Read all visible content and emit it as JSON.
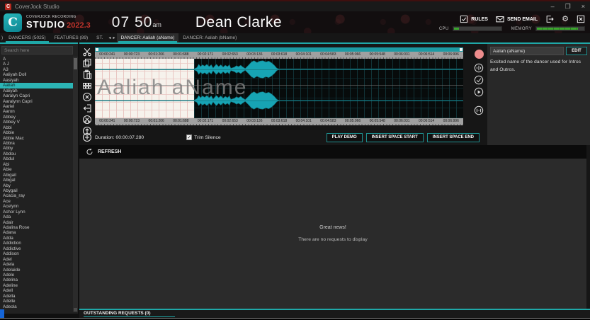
{
  "titlebar": {
    "app_title": "CoverJock Studio",
    "app_icon_letter": "C",
    "minimize": "–",
    "restore": "❐",
    "close": "×"
  },
  "header": {
    "logo_letter": "C",
    "brand_small": "COVERJOCK RECORDING",
    "brand_large": "STUDIO",
    "version": "2022.3",
    "time": "07 50",
    "time_suffix": "am",
    "user": "Dean Clarke",
    "rules_label": "RULES",
    "send_email_label": "SEND EMAIL",
    "gear_glyph": "⚙",
    "cpu_label": "CPU",
    "memory_label": "MEMORY",
    "cpu_percent": 10,
    "memory_percent": 85,
    "accent_color": "#1fa8a8",
    "meter_green": "#3aa72d"
  },
  "tabbar": {
    "fragment": ")",
    "nav_tabs": [
      {
        "label": "DANCERS (5025)"
      },
      {
        "label": "FEATURES (89)"
      },
      {
        "label": "ST."
      }
    ],
    "scroll_left": "◂",
    "scroll_right": "▸",
    "doc_tabs": [
      {
        "label": "DANCER: Aaliah (aName)",
        "active": true
      },
      {
        "label": "DANCER: Aaliah (bName)",
        "active": false
      }
    ]
  },
  "sidebar": {
    "search_placeholder": "Search here",
    "selected": "Aaliah",
    "items": [
      "A",
      "A J",
      "A3",
      "Aaliyah Doll",
      "Aasiyah",
      "Aaliah",
      "Aaliyah",
      "Aaralyn Capri",
      "Aaralynn Capri",
      "Aariel",
      "Aaron",
      "Abbey",
      "Abbey V",
      "Abbi",
      "Abbie",
      "Abbie Mac",
      "Abbra",
      "Abby",
      "Abdou",
      "Abdul",
      "Abi",
      "Abie",
      "Abigail",
      "Abigal",
      "Aby",
      "Abygail",
      "Acacia_ray",
      "Ace",
      "Acelynn",
      "Achor Lynn",
      "Ada",
      "Adair",
      "Adalina Rose",
      "Adana",
      "Adda",
      "Addiction",
      "Addictive",
      "Addison",
      "Adel",
      "Adela",
      "Adelaide",
      "Adele",
      "Adelina",
      "Adeline",
      "Adell",
      "Adella",
      "Adelle",
      "Adeola"
    ]
  },
  "wave": {
    "timeline": [
      "00:00:241",
      "00:00:723",
      "00:01:206",
      "00:01:688",
      "00:02:171",
      "00:02:653",
      "00:03:136",
      "00:03:618",
      "00:04:101",
      "00:04:583",
      "00:05:066",
      "00:05:548",
      "00:06:031",
      "00:06:514",
      "00:06:996"
    ],
    "watermark": "Aaliah aName",
    "duration_label": "Duration: 00:00:07.280",
    "trim_label": "Trim Silence",
    "check_glyph": "✓",
    "buttons": {
      "play": "PLAY DEMO",
      "insert_start": "INSERT SPACE START",
      "insert_end": "INSERT SPACE END"
    },
    "white_region_end": 0.27,
    "colors": {
      "wave": "#17a4b4",
      "wave_edge": "#0f6c76",
      "ruler": "#a0a0a0",
      "selection": "#1d9aa2"
    },
    "samples": [
      {
        "x": 0,
        "a": 0.015
      },
      {
        "x": 0.268,
        "a": 0.015
      },
      {
        "x": 0.277,
        "a": 0.2
      },
      {
        "x": 0.282,
        "a": 0.55
      },
      {
        "x": 0.287,
        "a": 0.3
      },
      {
        "x": 0.292,
        "a": 0.5
      },
      {
        "x": 0.298,
        "a": 0.35
      },
      {
        "x": 0.304,
        "a": 0.55
      },
      {
        "x": 0.31,
        "a": 0.3
      },
      {
        "x": 0.316,
        "a": 0.5
      },
      {
        "x": 0.321,
        "a": 0.15
      },
      {
        "x": 0.325,
        "a": 0.35
      },
      {
        "x": 0.33,
        "a": 0.55
      },
      {
        "x": 0.336,
        "a": 0.3
      },
      {
        "x": 0.342,
        "a": 0.5
      },
      {
        "x": 0.348,
        "a": 0.25
      },
      {
        "x": 0.354,
        "a": 0.45
      },
      {
        "x": 0.36,
        "a": 0.3
      },
      {
        "x": 0.365,
        "a": 0.5
      },
      {
        "x": 0.369,
        "a": 0.12
      },
      {
        "x": 0.379,
        "a": 0.25
      },
      {
        "x": 0.384,
        "a": 0.4
      },
      {
        "x": 0.39,
        "a": 0.3
      },
      {
        "x": 0.396,
        "a": 0.45
      },
      {
        "x": 0.402,
        "a": 0.25
      },
      {
        "x": 0.408,
        "a": 0.1
      },
      {
        "x": 0.417,
        "a": 0.45
      },
      {
        "x": 0.425,
        "a": 0.8
      },
      {
        "x": 0.432,
        "a": 0.95
      },
      {
        "x": 0.44,
        "a": 0.75
      },
      {
        "x": 0.448,
        "a": 0.9
      },
      {
        "x": 0.456,
        "a": 0.95
      },
      {
        "x": 0.464,
        "a": 0.8
      },
      {
        "x": 0.472,
        "a": 0.9
      },
      {
        "x": 0.48,
        "a": 0.7
      },
      {
        "x": 0.487,
        "a": 0.45
      },
      {
        "x": 0.494,
        "a": 0.12
      },
      {
        "x": 0.5,
        "a": 0.015
      },
      {
        "x": 1,
        "a": 0.015
      }
    ]
  },
  "right_panel": {
    "name_value": "Aaliah (aName)",
    "edit_label": "EDIT",
    "description": "Excited name of the dancer used for Intros and Outros."
  },
  "requests": {
    "refresh_label": "REFRESH",
    "empty_title": "Great news!",
    "empty_subtitle": "There are no requests to display",
    "footer": "OUTSTANDING REQUESTS (0)"
  }
}
